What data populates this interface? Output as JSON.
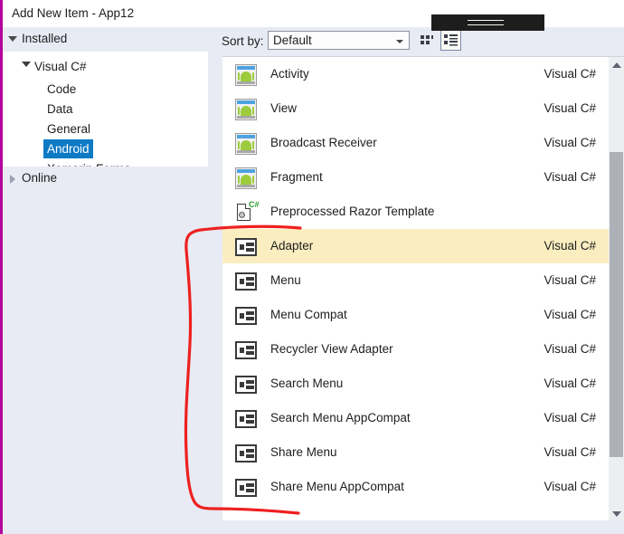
{
  "window": {
    "title": "Add New Item - App12",
    "accent_color": "#b4009e"
  },
  "tree": {
    "groups": [
      {
        "label": "Installed",
        "expanded": true,
        "expander_icon": "triangle-down-icon"
      },
      {
        "label": "Online",
        "expanded": false,
        "expander_icon": "triangle-right-icon"
      }
    ],
    "installed_nodes": [
      {
        "label": "Visual C#",
        "level": 1,
        "expanded": true,
        "selected": false
      },
      {
        "label": "Code",
        "level": 2,
        "expanded": false,
        "selected": false
      },
      {
        "label": "Data",
        "level": 2,
        "expanded": false,
        "selected": false
      },
      {
        "label": "General",
        "level": 2,
        "expanded": false,
        "selected": false
      },
      {
        "label": "Android",
        "level": 2,
        "expanded": false,
        "selected": true
      },
      {
        "label": "Xamarin.Forms",
        "level": 2,
        "expanded": false,
        "selected": false
      }
    ],
    "selection_color": "#0d7ac4"
  },
  "sortbar": {
    "label": "Sort by:",
    "combo_value": "Default",
    "combo_placeholder": "Default",
    "combo_arrow_icon": "chevron-down-icon",
    "tiles_view_icon": "tile-view-icon",
    "list_view_icon": "list-view-icon",
    "list_view_selected": true
  },
  "list": {
    "selected_row_color": "#faeec1",
    "items": [
      {
        "name": "Activity",
        "language": "Visual C#",
        "icon": "android-activity-icon",
        "selected": false
      },
      {
        "name": "View",
        "language": "Visual C#",
        "icon": "android-activity-icon",
        "selected": false
      },
      {
        "name": "Broadcast Receiver",
        "language": "Visual C#",
        "icon": "android-activity-icon",
        "selected": false
      },
      {
        "name": "Fragment",
        "language": "Visual C#",
        "icon": "android-activity-icon",
        "selected": false
      },
      {
        "name": "Preprocessed Razor Template",
        "language": "",
        "icon": "razor-template-icon",
        "selected": false
      },
      {
        "name": "Adapter",
        "language": "Visual C#",
        "icon": "list-item-icon",
        "selected": true
      },
      {
        "name": "Menu",
        "language": "Visual C#",
        "icon": "list-item-icon",
        "selected": false
      },
      {
        "name": "Menu Compat",
        "language": "Visual C#",
        "icon": "list-item-icon",
        "selected": false
      },
      {
        "name": "Recycler View Adapter",
        "language": "Visual C#",
        "icon": "list-item-icon",
        "selected": false
      },
      {
        "name": "Search Menu",
        "language": "Visual C#",
        "icon": "list-item-icon",
        "selected": false
      },
      {
        "name": "Search Menu AppCompat",
        "language": "Visual C#",
        "icon": "list-item-icon",
        "selected": false
      },
      {
        "name": "Share Menu",
        "language": "Visual C#",
        "icon": "list-item-icon",
        "selected": false
      },
      {
        "name": "Share Menu AppCompat",
        "language": "Visual C#",
        "icon": "list-item-icon",
        "selected": false
      }
    ]
  },
  "scrollbar": {
    "up_arrow_icon": "scroll-up-arrow-icon",
    "down_arrow_icon": "scroll-down-arrow-icon"
  },
  "annotation": {
    "color": "#ee2020",
    "shape": "hand-drawn-bracket"
  },
  "redaction": {
    "present": true,
    "color": "#1d1d1d"
  }
}
